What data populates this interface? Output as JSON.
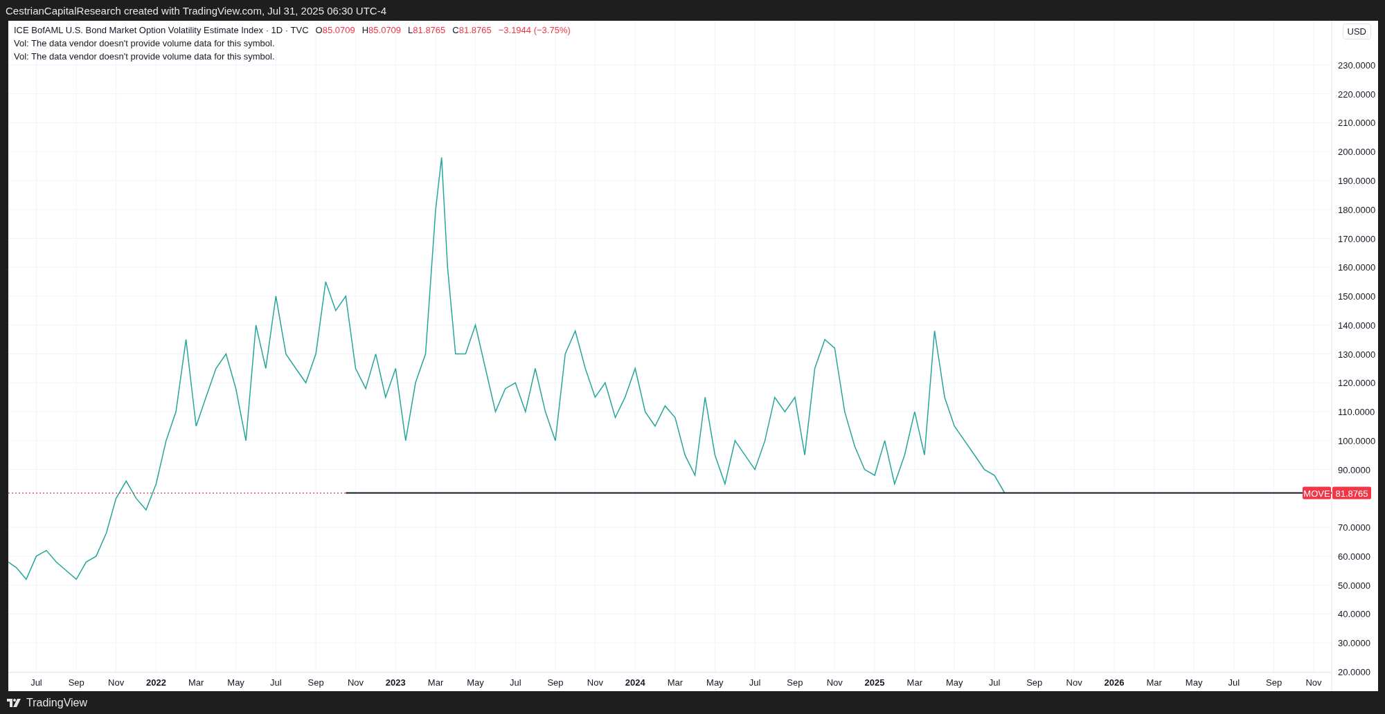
{
  "header": {
    "text": "CestrianCapitalResearch created with TradingView.com, Jul 31, 2025 06:30 UTC-4"
  },
  "legend": {
    "title": "ICE BofAML U.S. Bond Market Option Volatility Estimate Index · 1D · TVC",
    "ohlc": [
      {
        "label": "O",
        "value": "85.0709"
      },
      {
        "label": "H",
        "value": "85.0709"
      },
      {
        "label": "L",
        "value": "81.8765"
      },
      {
        "label": "C",
        "value": "81.8765"
      }
    ],
    "change": "−3.1944 (−3.75%)",
    "notes": [
      "Vol: The data vendor doesn't provide volume data for this symbol.",
      "Vol: The data vendor doesn't provide volume data for this symbol."
    ]
  },
  "price_axis": {
    "currency": "USD"
  },
  "price_badge": {
    "value": "81.8765"
  },
  "chart_data": {
    "type": "line",
    "xlim": [
      2021.383,
      2026.908
    ],
    "ylim": [
      19.76,
      245.3
    ],
    "x": [
      2021.383,
      2021.417,
      2021.458,
      2021.5,
      2021.542,
      2021.583,
      2021.625,
      2021.667,
      2021.708,
      2021.75,
      2021.792,
      2021.833,
      2021.875,
      2021.917,
      2021.958,
      2022.0,
      2022.042,
      2022.083,
      2022.125,
      2022.167,
      2022.208,
      2022.25,
      2022.292,
      2022.333,
      2022.375,
      2022.417,
      2022.458,
      2022.5,
      2022.542,
      2022.583,
      2022.625,
      2022.667,
      2022.708,
      2022.75,
      2022.792,
      2022.833,
      2022.875,
      2022.917,
      2022.958,
      2023.0,
      2023.042,
      2023.083,
      2023.125,
      2023.167,
      2023.192,
      2023.217,
      2023.25,
      2023.292,
      2023.333,
      2023.375,
      2023.417,
      2023.458,
      2023.5,
      2023.542,
      2023.583,
      2023.625,
      2023.667,
      2023.708,
      2023.75,
      2023.792,
      2023.833,
      2023.875,
      2023.917,
      2023.958,
      2024.0,
      2024.042,
      2024.083,
      2024.125,
      2024.167,
      2024.208,
      2024.25,
      2024.292,
      2024.333,
      2024.375,
      2024.417,
      2024.458,
      2024.5,
      2024.542,
      2024.583,
      2024.625,
      2024.667,
      2024.708,
      2024.75,
      2024.792,
      2024.833,
      2024.875,
      2024.917,
      2024.958,
      2025.0,
      2025.042,
      2025.083,
      2025.125,
      2025.167,
      2025.208,
      2025.25,
      2025.292,
      2025.333,
      2025.375,
      2025.417,
      2025.458,
      2025.5,
      2025.542
    ],
    "series": [
      {
        "name": "MOVE",
        "color": "#26a69a",
        "values": [
          58,
          56,
          52,
          60,
          62,
          58,
          55,
          52,
          58,
          60,
          68,
          80,
          86,
          80,
          76,
          85,
          100,
          110,
          135,
          105,
          115,
          125,
          130,
          118,
          100,
          140,
          125,
          150,
          130,
          125,
          120,
          130,
          155,
          145,
          150,
          125,
          118,
          130,
          115,
          125,
          100,
          120,
          130,
          180,
          198,
          160,
          130,
          130,
          140,
          125,
          110,
          118,
          120,
          110,
          125,
          110,
          100,
          130,
          138,
          125,
          115,
          120,
          108,
          115,
          125,
          110,
          105,
          112,
          108,
          95,
          88,
          115,
          95,
          85,
          100,
          95,
          90,
          100,
          115,
          110,
          115,
          95,
          125,
          135,
          132,
          110,
          98,
          90,
          88,
          100,
          85,
          95,
          110,
          95,
          138,
          115,
          105,
          100,
          95,
          90,
          88,
          82
        ]
      }
    ],
    "yticks": [
      {
        "value": 20,
        "label": "20.0000"
      },
      {
        "value": 30,
        "label": "30.0000"
      },
      {
        "value": 40,
        "label": "40.0000"
      },
      {
        "value": 50,
        "label": "50.0000"
      },
      {
        "value": 60,
        "label": "60.0000"
      },
      {
        "value": 70,
        "label": "70.0000"
      },
      {
        "value": 90,
        "label": "90.0000"
      },
      {
        "value": 100,
        "label": "100.0000"
      },
      {
        "value": 110,
        "label": "110.0000"
      },
      {
        "value": 120,
        "label": "120.0000"
      },
      {
        "value": 130,
        "label": "130.0000"
      },
      {
        "value": 140,
        "label": "140.0000"
      },
      {
        "value": 150,
        "label": "150.0000"
      },
      {
        "value": 160,
        "label": "160.0000"
      },
      {
        "value": 170,
        "label": "170.0000"
      },
      {
        "value": 180,
        "label": "180.0000"
      },
      {
        "value": 190,
        "label": "190.0000"
      },
      {
        "value": 200,
        "label": "200.0000"
      },
      {
        "value": 210,
        "label": "210.0000"
      },
      {
        "value": 220,
        "label": "220.0000"
      },
      {
        "value": 230,
        "label": "230.0000"
      }
    ],
    "xticks": [
      {
        "value": 2021.5,
        "label": "Jul"
      },
      {
        "value": 2021.667,
        "label": "Sep"
      },
      {
        "value": 2021.833,
        "label": "Nov"
      },
      {
        "value": 2022,
        "label": "2022"
      },
      {
        "value": 2022.167,
        "label": "Mar"
      },
      {
        "value": 2022.333,
        "label": "May"
      },
      {
        "value": 2022.5,
        "label": "Jul"
      },
      {
        "value": 2022.667,
        "label": "Sep"
      },
      {
        "value": 2022.833,
        "label": "Nov"
      },
      {
        "value": 2023,
        "label": "2023"
      },
      {
        "value": 2023.167,
        "label": "Mar"
      },
      {
        "value": 2023.333,
        "label": "May"
      },
      {
        "value": 2023.5,
        "label": "Jul"
      },
      {
        "value": 2023.667,
        "label": "Sep"
      },
      {
        "value": 2023.833,
        "label": "Nov"
      },
      {
        "value": 2024,
        "label": "2024"
      },
      {
        "value": 2024.167,
        "label": "Mar"
      },
      {
        "value": 2024.333,
        "label": "May"
      },
      {
        "value": 2024.5,
        "label": "Jul"
      },
      {
        "value": 2024.667,
        "label": "Sep"
      },
      {
        "value": 2024.833,
        "label": "Nov"
      },
      {
        "value": 2025,
        "label": "2025"
      },
      {
        "value": 2025.167,
        "label": "Mar"
      },
      {
        "value": 2025.333,
        "label": "May"
      },
      {
        "value": 2025.5,
        "label": "Jul"
      },
      {
        "value": 2025.667,
        "label": "Sep"
      },
      {
        "value": 2025.833,
        "label": "Nov"
      },
      {
        "value": 2026,
        "label": "2026"
      },
      {
        "value": 2026.167,
        "label": "Mar"
      },
      {
        "value": 2026.333,
        "label": "May"
      },
      {
        "value": 2026.5,
        "label": "Jul"
      },
      {
        "value": 2026.667,
        "label": "Sep"
      },
      {
        "value": 2026.833,
        "label": "Nov"
      }
    ],
    "grid": true
  },
  "footer": {
    "brand": "TradingView"
  }
}
